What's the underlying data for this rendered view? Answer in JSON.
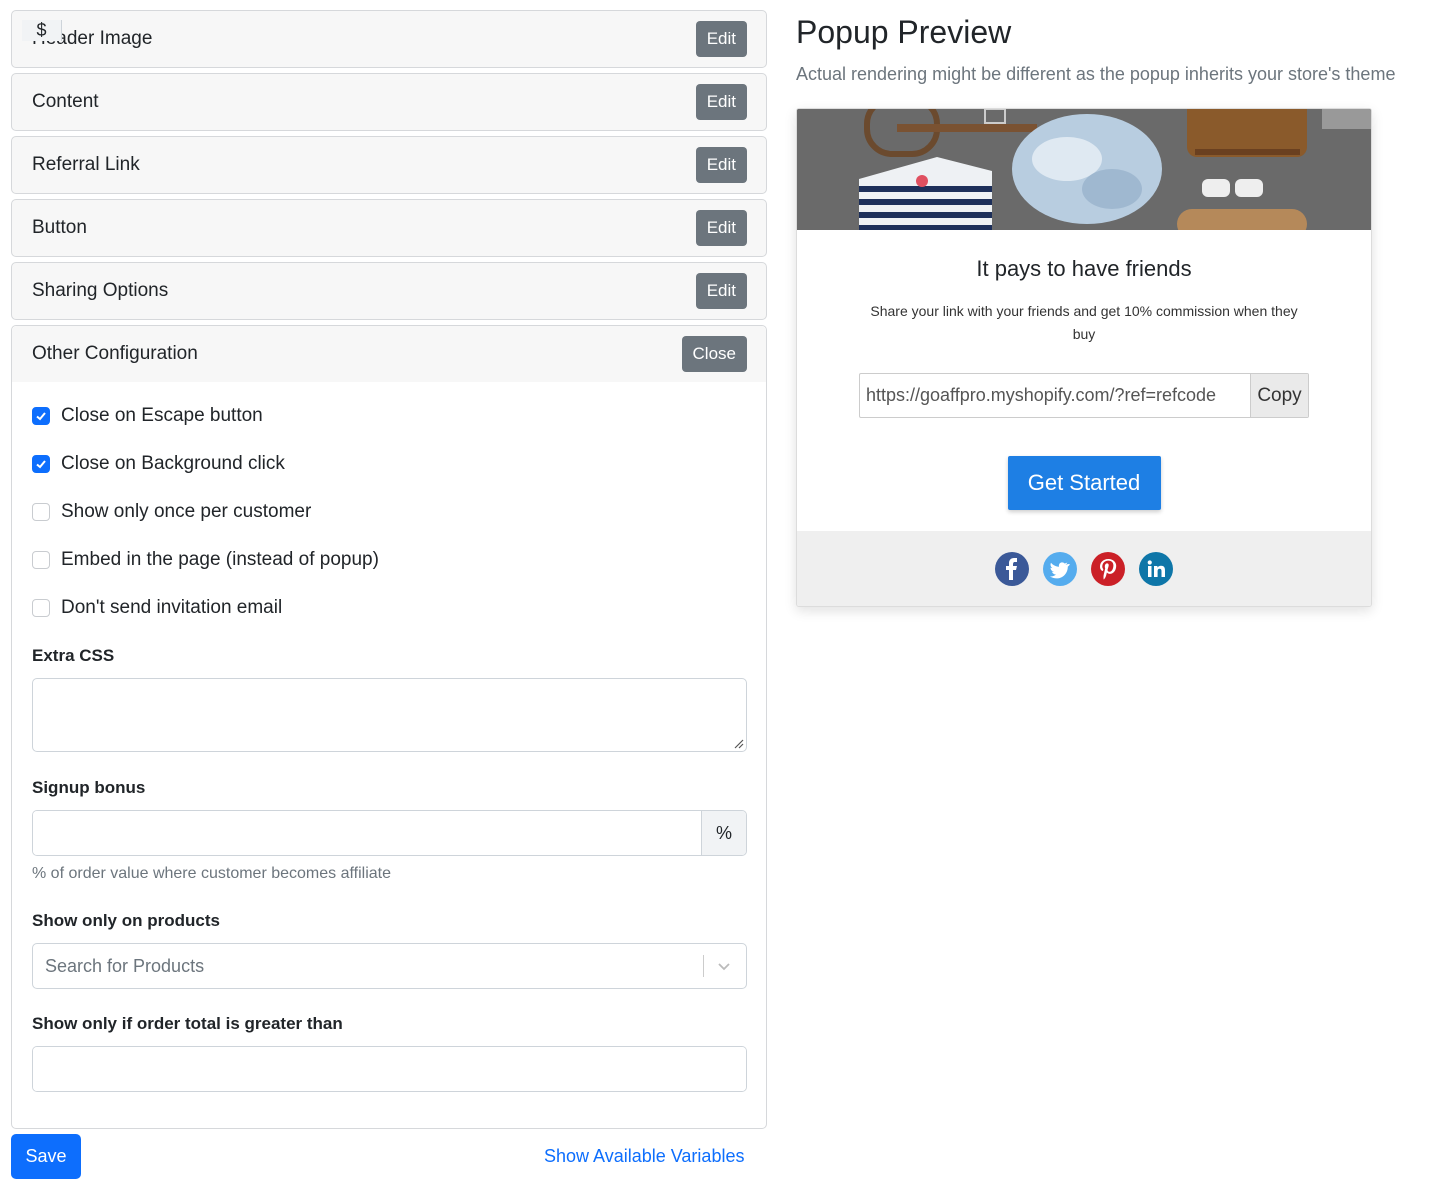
{
  "accordion": {
    "sections": [
      {
        "title": "Header Image",
        "action": "Edit"
      },
      {
        "title": "Content",
        "action": "Edit"
      },
      {
        "title": "Referral Link",
        "action": "Edit"
      },
      {
        "title": "Button",
        "action": "Edit"
      },
      {
        "title": "Sharing Options",
        "action": "Edit"
      }
    ],
    "open_section": {
      "title": "Other Configuration",
      "action": "Close"
    }
  },
  "other_config": {
    "checkboxes": [
      {
        "label": "Close on Escape button",
        "checked": true
      },
      {
        "label": "Close on Background click",
        "checked": true
      },
      {
        "label": "Show only once per customer",
        "checked": false
      },
      {
        "label": "Embed in the page (instead of popup)",
        "checked": false
      },
      {
        "label": "Don't send invitation email",
        "checked": false
      }
    ],
    "extra_css": {
      "label": "Extra CSS",
      "value": ""
    },
    "signup_bonus": {
      "label": "Signup bonus",
      "value": "",
      "suffix": "%",
      "help": "% of order value where customer becomes affiliate"
    },
    "products": {
      "label": "Show only on products",
      "placeholder": "Search for Products"
    },
    "order_total": {
      "label": "Show only if order total is greater than",
      "prefix": "$",
      "value": ""
    }
  },
  "footer": {
    "save_label": "Save",
    "variables_link": "Show Available Variables"
  },
  "preview": {
    "title": "Popup Preview",
    "subtitle": "Actual rendering might be different as the popup inherits your store's theme",
    "popup": {
      "heading": "It pays to have friends",
      "text": "Share your link with your friends and get 10% commission when they buy",
      "link": "https://goaffpro.myshopify.com/?ref=refcode",
      "copy_label": "Copy",
      "button_label": "Get Started",
      "social": [
        "facebook-icon",
        "twitter-icon",
        "pinterest-icon",
        "linkedin-icon"
      ]
    }
  },
  "colors": {
    "primary": "#0d6efd",
    "secondary": "#6c757d",
    "popup_button": "#1e7fe4"
  }
}
